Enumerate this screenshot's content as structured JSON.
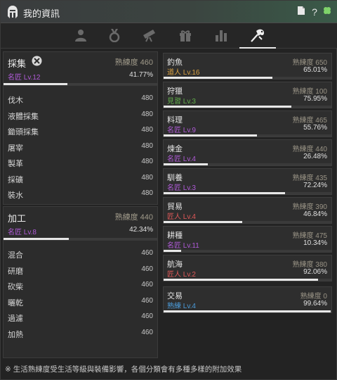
{
  "window": {
    "title": "我的資訊"
  },
  "titlebar": {
    "doc_icon": "document-icon",
    "help_label": "?",
    "clover_icon": "clover-icon"
  },
  "tabs": [
    {
      "icon": "person-icon",
      "active": false
    },
    {
      "icon": "medal-icon",
      "active": false
    },
    {
      "icon": "telescope-icon",
      "active": false
    },
    {
      "icon": "gift-icon",
      "active": false
    },
    {
      "icon": "bar-chart-icon",
      "active": false
    },
    {
      "icon": "fishing-icon",
      "active": true
    }
  ],
  "gathering": {
    "title": "採集",
    "proficiency": "熟練度 460",
    "grade": "名匠 Lv.12",
    "percent": "41.77%",
    "progress": 0.4177,
    "items": [
      {
        "name": "伐木",
        "value": "480"
      },
      {
        "name": "液體採集",
        "value": "480"
      },
      {
        "name": "鋤頭採集",
        "value": "480"
      },
      {
        "name": "屠宰",
        "value": "480"
      },
      {
        "name": "製革",
        "value": "480"
      },
      {
        "name": "採礦",
        "value": "480"
      },
      {
        "name": "裝水",
        "value": "480"
      }
    ]
  },
  "processing": {
    "title": "加工",
    "proficiency": "熟練度 440",
    "grade": "名匠 Lv.8",
    "percent": "42.34%",
    "progress": 0.4234,
    "items": [
      {
        "name": "混合",
        "value": "460"
      },
      {
        "name": "研磨",
        "value": "460"
      },
      {
        "name": "砍柴",
        "value": "460"
      },
      {
        "name": "曬乾",
        "value": "460"
      },
      {
        "name": "過濾",
        "value": "460"
      },
      {
        "name": "加熱",
        "value": "460"
      }
    ]
  },
  "skills": [
    {
      "name": "釣魚",
      "proficiency": "熟練度 650",
      "grade": "道人 Lv.16",
      "grade_class": "g-expert",
      "percent": "65.01%",
      "progress": 0.6501
    },
    {
      "name": "狩獵",
      "proficiency": "熟練度 100",
      "grade": "見習 Lv.3",
      "grade_class": "g-pro",
      "percent": "75.95%",
      "progress": 0.7595
    },
    {
      "name": "料理",
      "proficiency": "熟練度 465",
      "grade": "名匠 Lv.9",
      "grade_class": "g-master",
      "percent": "55.76%",
      "progress": 0.5576
    },
    {
      "name": "煉金",
      "proficiency": "熟練度 440",
      "grade": "名匠 Lv.4",
      "grade_class": "g-master",
      "percent": "26.48%",
      "progress": 0.2648
    },
    {
      "name": "馴養",
      "proficiency": "熟練度 435",
      "grade": "名匠 Lv.3",
      "grade_class": "g-master",
      "percent": "72.24%",
      "progress": 0.7224
    },
    {
      "name": "貿易",
      "proficiency": "熟練度 390",
      "grade": "匠人 Lv.4",
      "grade_class": "g-artisan",
      "percent": "46.84%",
      "progress": 0.4684
    },
    {
      "name": "耕種",
      "proficiency": "熟練度 475",
      "grade": "名匠 Lv.11",
      "grade_class": "g-master",
      "percent": "10.34%",
      "progress": 0.1034
    },
    {
      "name": "航海",
      "proficiency": "熟練度 380",
      "grade": "匠人 Lv.2",
      "grade_class": "g-artisan",
      "percent": "92.06%",
      "progress": 0.9206
    },
    {
      "name": "交易",
      "proficiency": "熟練度 0",
      "grade": "熟練 Lv.4",
      "grade_class": "g-skilled",
      "percent": "99.64%",
      "progress": 0.9964
    }
  ],
  "footer": {
    "note": "※ 生活熟練度受生活等級與裝備影響，各個分類會有多種多樣的附加效果"
  }
}
